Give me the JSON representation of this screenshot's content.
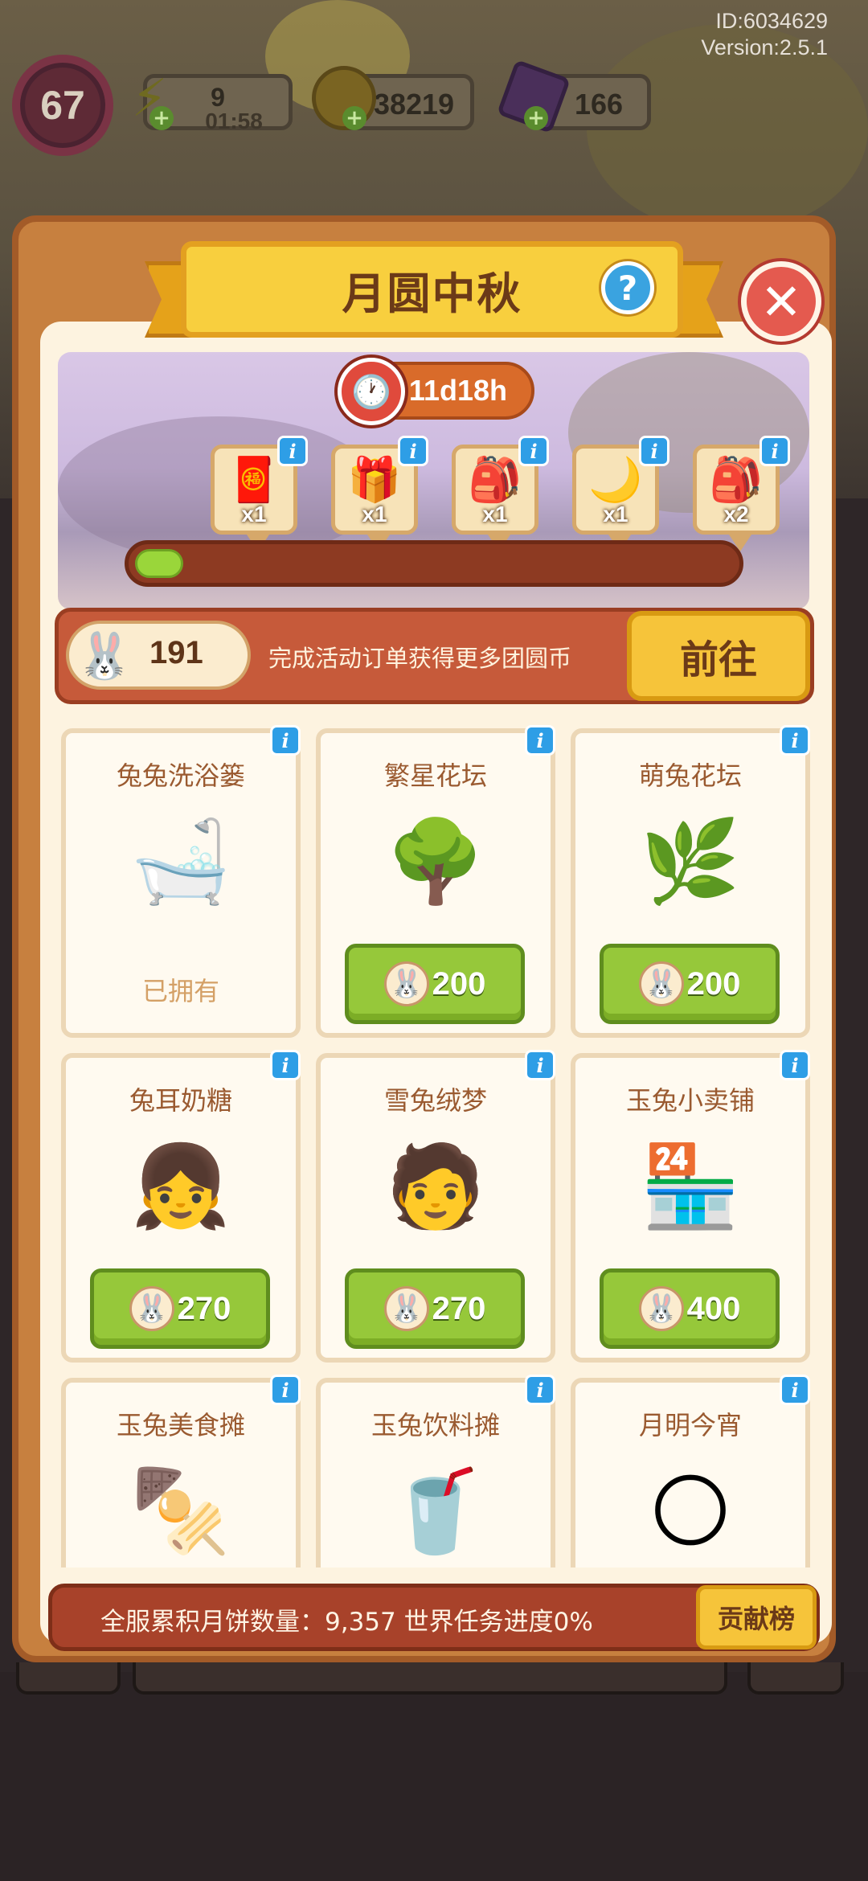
{
  "hud": {
    "id_text": "ID:6034629",
    "version_text": "Version:2.5.1",
    "level": "67",
    "energy": {
      "value": "9",
      "timer": "01:58",
      "icon": "lightning-icon"
    },
    "coins": {
      "value": "38219",
      "icon": "coin-icon"
    },
    "gems": {
      "value": "166",
      "icon": "gem-icon"
    }
  },
  "panel": {
    "title": "月圆中秋",
    "help_symbol": "?",
    "close_symbol": "✕"
  },
  "event": {
    "timer": "11d18h",
    "progress_fraction": 0.08,
    "rewards": [
      {
        "icon": "red-chest-icon",
        "glyph": "🧧",
        "qty": "x1"
      },
      {
        "icon": "decorated-chest-icon",
        "glyph": "🎁",
        "qty": "x1"
      },
      {
        "icon": "pink-backpack-icon",
        "glyph": "🎒",
        "qty": "x1"
      },
      {
        "icon": "moon-wand-icon",
        "glyph": "🌙",
        "qty": "x1"
      },
      {
        "icon": "pink-backpack-icon",
        "glyph": "🎒",
        "qty": "x2"
      }
    ]
  },
  "currency": {
    "amount": "191",
    "hint": "完成活动订单获得更多团圆币",
    "goto_label": "前往"
  },
  "shop_items": [
    {
      "name": "兔兔洗浴篓",
      "glyph": "🛁",
      "owned": true,
      "owned_label": "已拥有",
      "price": ""
    },
    {
      "name": "繁星花坛",
      "glyph": "🌳",
      "owned": false,
      "price": "200"
    },
    {
      "name": "萌兔花坛",
      "glyph": "🌿",
      "owned": false,
      "price": "200"
    },
    {
      "name": "兔耳奶糖",
      "glyph": "👧",
      "owned": false,
      "price": "270"
    },
    {
      "name": "雪兔绒梦",
      "glyph": "🧑",
      "owned": false,
      "price": "270"
    },
    {
      "name": "玉兔小卖铺",
      "glyph": "🏪",
      "owned": false,
      "price": "400"
    },
    {
      "name": "玉兔美食摊",
      "glyph": "🍢",
      "owned": false,
      "price": ""
    },
    {
      "name": "玉兔饮料摊",
      "glyph": "🥤",
      "owned": false,
      "price": ""
    },
    {
      "name": "月明今宵",
      "glyph": "🌕",
      "owned": false,
      "price": ""
    }
  ],
  "footer": {
    "text": "全服累积月饼数量：9,357  世界任务进度0%",
    "rank_label": "贡献榜"
  },
  "colors": {
    "panel": "#c7803f",
    "accent_yellow": "#f8cf3e",
    "price_green": "#96c83a",
    "info_blue": "#2e9ee6"
  }
}
